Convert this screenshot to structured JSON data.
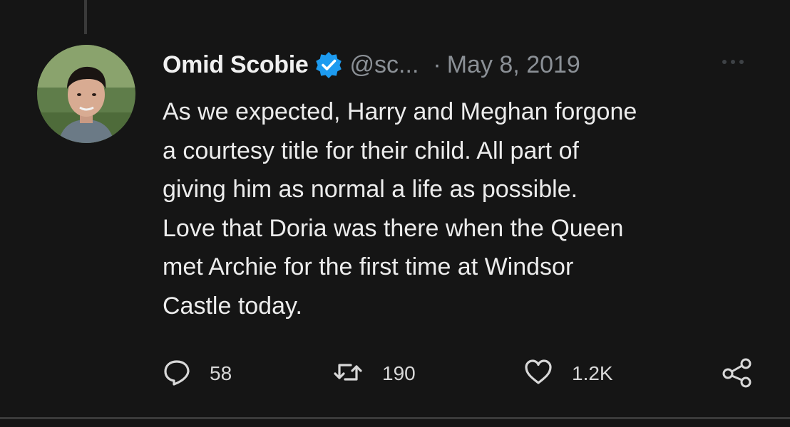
{
  "tweet": {
    "author_name": "Omid Scobie",
    "handle": "@sc...",
    "separator": "·",
    "date": "May 8, 2019",
    "text": "As we expected, Harry and Meghan forgone\na courtesy title for their child. All part of\ngiving him as normal a life as possible.\nLove that Doria was there when the Queen\nmet Archie for the first time at Windsor\nCastle today.",
    "verified_icon": "verified-badge-icon",
    "more_icon": "more-options-icon"
  },
  "actions": {
    "reply": {
      "icon": "reply-icon",
      "count": "58"
    },
    "retweet": {
      "icon": "retweet-icon",
      "count": "190"
    },
    "like": {
      "icon": "heart-icon",
      "count": "1.2K"
    },
    "share": {
      "icon": "share-icon"
    }
  },
  "colors": {
    "background": "#151515",
    "text": "#ececec",
    "muted": "#8b9096",
    "verified": "#1d9bf0"
  }
}
